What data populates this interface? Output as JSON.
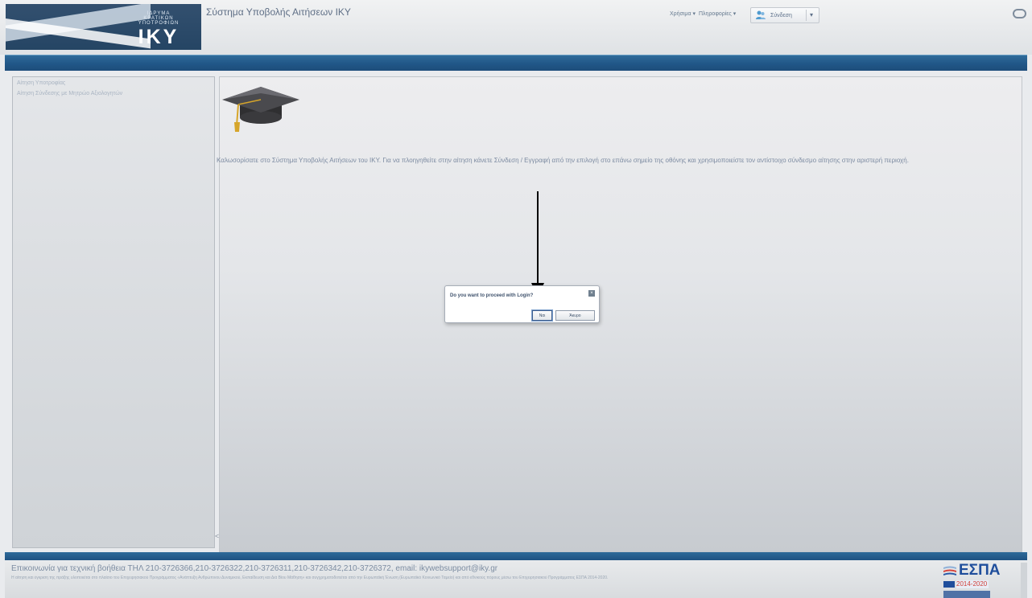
{
  "header": {
    "logo_small_lines": [
      "ΙΔΡΥΜΑ",
      "ΚΡΑΤΙΚΩΝ",
      "ΥΠΟΤΡΟΦΙΩΝ"
    ],
    "logo_text": "IKY",
    "app_title": "Σύστημα Υποβολής Αιτήσεων ΙΚΥ",
    "menu_1": "Χρήσιμα ▾",
    "menu_2": "Πληροφορίες ▾",
    "user_label": "Σύνδεση",
    "user_caret": "▾"
  },
  "sidebar": {
    "items": [
      {
        "label": "Αίτηση Υποτροφίας"
      },
      {
        "label": "Αίτηση Σύνδεσης με Μητρώο Αξιολογητών"
      }
    ],
    "handle": "<"
  },
  "main": {
    "welcome_text": "Καλωσορίσατε στο Σύστημα Υποβολής Αιτήσεων του ΙΚΥ. Για να πλοηγηθείτε στην αίτηση κάνετε Σύνδεση / Εγγραφή από την επιλογή στο επάνω σημείο της οθόνης και χρησιμοποιείστε τον αντίστοιχο σύνδεσμο αίτησης στην αριστερή περιοχή."
  },
  "dialog": {
    "question": "Do you want to proceed with Login?",
    "close": "×",
    "yes_label": "Ναι",
    "cancel_label": "Άκυρο"
  },
  "footer": {
    "contact": "Επικοινωνία για τεχνική βοήθεια ΤΗΛ 210-3726366,210-3726322,210-3726311,210-3726342,210-3726372, email: ikywebsupport@iky.gr",
    "fine_print": "Η αίτηση και έγκριση της πράξης υλοποιείται στο πλαίσιο του Επιχειρησιακού Προγράμματος «Ανάπτυξη Ανθρώπινου Δυναμικού, Εκπαίδευση και Διά Βίου Μάθηση» και συγχρηματοδοτείται από την Ευρωπαϊκή Ένωση (Ευρωπαϊκό Κοινωνικό Ταμείο) και από εθνικούς πόρους μέσω του Επιχειρησιακού Προγράμματος ΕΣΠΑ 2014-2020.",
    "espa_name": "ΕΣΠΑ",
    "espa_years": "2014-2020"
  },
  "colors": {
    "accent_blue": "#205586",
    "arrow": "#000000",
    "cap": "#3d3d3d",
    "tassel": "#d6a52a"
  }
}
